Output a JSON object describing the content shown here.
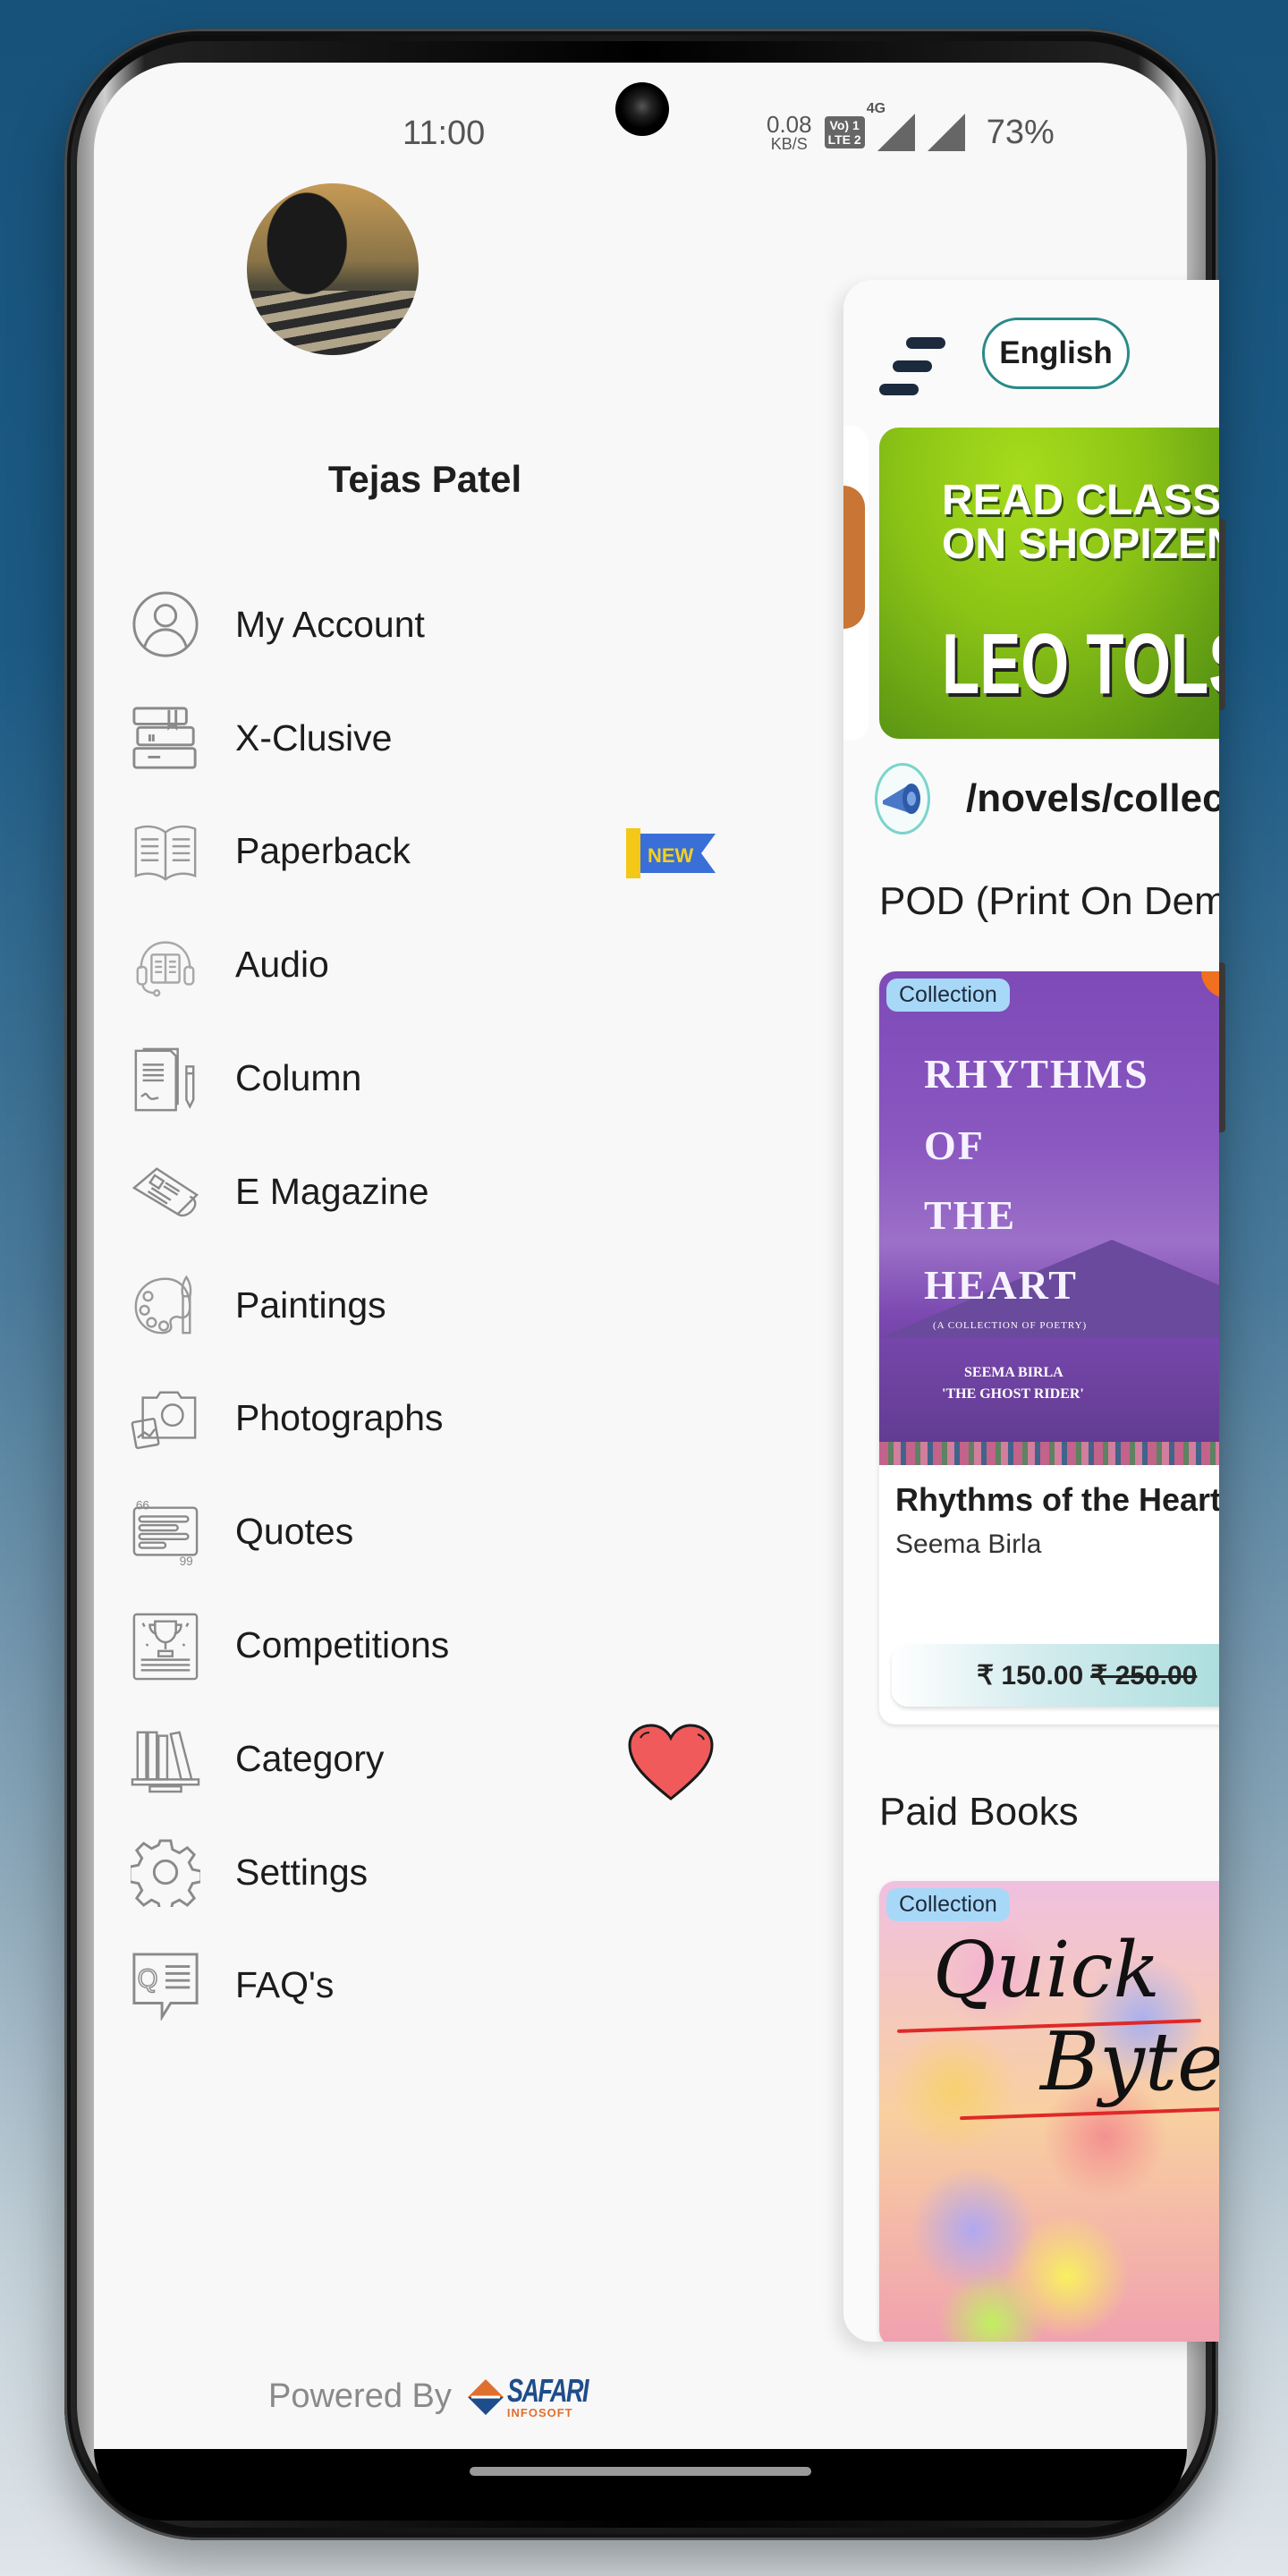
{
  "status_bar": {
    "time": "11:00",
    "net_speed_value": "0.08",
    "net_speed_unit": "KB/S",
    "volte_line1": "Vo) 1",
    "volte_line2": "LTE 2",
    "network_type": "4G",
    "battery": "73%"
  },
  "drawer": {
    "user_name": "Tejas Patel",
    "menu": [
      {
        "label": "My Account",
        "icon": "user-circle-icon"
      },
      {
        "label": "X-Clusive",
        "icon": "book-stack-icon"
      },
      {
        "label": "Paperback",
        "icon": "open-book-icon",
        "badge": "NEW"
      },
      {
        "label": "Audio",
        "icon": "audiobook-headphones-icon"
      },
      {
        "label": "Column",
        "icon": "document-pen-icon"
      },
      {
        "label": "E Magazine",
        "icon": "newspaper-icon"
      },
      {
        "label": "Paintings",
        "icon": "palette-brush-icon"
      },
      {
        "label": "Photographs",
        "icon": "camera-photo-icon"
      },
      {
        "label": "Quotes",
        "icon": "quote-card-icon"
      },
      {
        "label": "Competitions",
        "icon": "trophy-certificate-icon"
      },
      {
        "label": "Category",
        "icon": "bookshelf-icon",
        "decoration": "heart"
      },
      {
        "label": "Settings",
        "icon": "gear-icon"
      },
      {
        "label": "FAQ's",
        "icon": "faq-bubble-icon"
      }
    ],
    "powered_by": "Powered By",
    "brand_name": "SAFARI",
    "brand_sub": "INFOSOFT"
  },
  "main": {
    "language_button": "English",
    "banner": {
      "line1": "READ CLASSICS",
      "line2": "ON SHOPIZEN",
      "line3": "LEO TOLSTOY"
    },
    "notice_text": "/novels/collection",
    "sections": [
      {
        "title": "POD (Print On Demand)",
        "books": [
          {
            "tag": "Collection",
            "cover_title_lines": [
              "RHYTHMS",
              "OF",
              "THE",
              "HEART"
            ],
            "cover_subtitle": "(A COLLECTION OF POETRY)",
            "cover_author_lines": [
              "SEEMA BIRLA",
              "'THE GHOST RIDER'"
            ],
            "title": "Rhythms of the Heart",
            "author": "Seema Birla",
            "price": "₹ 150.00",
            "original_price": "₹ 250.00"
          }
        ]
      },
      {
        "title": "Paid Books",
        "books": [
          {
            "tag": "Collection",
            "cover_title_lines": [
              "Quick",
              "Bytes"
            ]
          }
        ]
      }
    ]
  },
  "colors": {
    "accent_teal": "#2a8a88",
    "badge_blue": "#3a6fd8",
    "badge_yellow": "#f4c816",
    "heart_red": "#f05a5a",
    "tag_blue": "#a8d8f8"
  }
}
